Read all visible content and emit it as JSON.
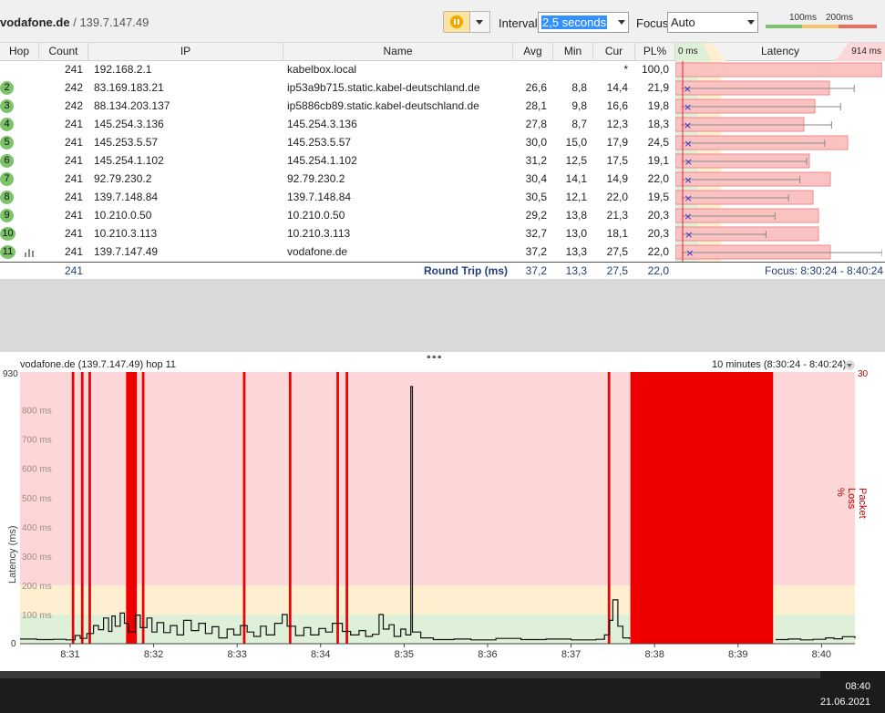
{
  "header": {
    "target_host": "vodafone.de",
    "separator": "/",
    "target_ip": "139.7.147.49",
    "interval_label": "Interval",
    "interval_value": "2,5 seconds",
    "focus_label": "Focus",
    "focus_value": "Auto",
    "scale_100": "100ms",
    "scale_200": "200ms",
    "pause_icon": "pause-icon"
  },
  "columns": {
    "hop": "Hop",
    "count": "Count",
    "ip": "IP",
    "name": "Name",
    "avg": "Avg",
    "min": "Min",
    "cur": "Cur",
    "pl": "PL%",
    "lat_min": "0 ms",
    "latency": "Latency",
    "lat_max": "914 ms"
  },
  "hops": [
    {
      "hop": "",
      "count": "241",
      "ip": "192.168.2.1",
      "name": "kabelbox.local",
      "avg": "",
      "min": "",
      "cur": "*",
      "pl": "100,0",
      "plf": 1.0,
      "avgv": 0,
      "minv": 0,
      "maxv": 0,
      "curv": 0
    },
    {
      "hop": "2",
      "count": "242",
      "ip": "83.169.183.21",
      "name": "ip53a9b715.static.kabel-deutschland.de",
      "avg": "26,6",
      "min": "8,8",
      "cur": "14,4",
      "pl": "21,9",
      "plf": 0.219,
      "avgv": 26.6,
      "minv": 8.8,
      "maxv": 790,
      "curv": 14.4
    },
    {
      "hop": "3",
      "count": "242",
      "ip": "88.134.203.137",
      "name": "ip5886cb89.static.kabel-deutschland.de",
      "avg": "28,1",
      "min": "9,8",
      "cur": "16,6",
      "pl": "19,8",
      "plf": 0.198,
      "avgv": 28.1,
      "minv": 9.8,
      "maxv": 730,
      "curv": 16.6
    },
    {
      "hop": "4",
      "count": "241",
      "ip": "145.254.3.136",
      "name": "145.254.3.136",
      "avg": "27,8",
      "min": "8,7",
      "cur": "12,3",
      "pl": "18,3",
      "plf": 0.183,
      "avgv": 27.8,
      "minv": 8.7,
      "maxv": 690,
      "curv": 12.3
    },
    {
      "hop": "5",
      "count": "241",
      "ip": "145.253.5.57",
      "name": "145.253.5.57",
      "avg": "30,0",
      "min": "15,0",
      "cur": "17,9",
      "pl": "24,5",
      "plf": 0.245,
      "avgv": 30.0,
      "minv": 15.0,
      "maxv": 660,
      "curv": 17.9
    },
    {
      "hop": "6",
      "count": "241",
      "ip": "145.254.1.102",
      "name": "145.254.1.102",
      "avg": "31,2",
      "min": "12,5",
      "cur": "17,5",
      "pl": "19,1",
      "plf": 0.191,
      "avgv": 31.2,
      "minv": 12.5,
      "maxv": 580,
      "curv": 17.5
    },
    {
      "hop": "7",
      "count": "241",
      "ip": "92.79.230.2",
      "name": "92.79.230.2",
      "avg": "30,4",
      "min": "14,1",
      "cur": "14,9",
      "pl": "22,0",
      "plf": 0.22,
      "avgv": 30.4,
      "minv": 14.1,
      "maxv": 550,
      "curv": 14.9
    },
    {
      "hop": "8",
      "count": "241",
      "ip": "139.7.148.84",
      "name": "139.7.148.84",
      "avg": "30,5",
      "min": "12,1",
      "cur": "22,0",
      "pl": "19,5",
      "plf": 0.195,
      "avgv": 30.5,
      "minv": 12.1,
      "maxv": 500,
      "curv": 22.0
    },
    {
      "hop": "9",
      "count": "241",
      "ip": "10.210.0.50",
      "name": "10.210.0.50",
      "avg": "29,2",
      "min": "13,8",
      "cur": "21,3",
      "pl": "20,3",
      "plf": 0.203,
      "avgv": 29.2,
      "minv": 13.8,
      "maxv": 440,
      "curv": 21.3
    },
    {
      "hop": "10",
      "count": "241",
      "ip": "10.210.3.113",
      "name": "10.210.3.113",
      "avg": "32,7",
      "min": "13,0",
      "cur": "18,1",
      "pl": "20,3",
      "plf": 0.203,
      "avgv": 32.7,
      "minv": 13.0,
      "maxv": 400,
      "curv": 18.1
    },
    {
      "hop": "11",
      "count": "241",
      "ip": "139.7.147.49",
      "name": "vodafone.de",
      "avg": "37,2",
      "min": "13,3",
      "cur": "27,5",
      "pl": "22,0",
      "plf": 0.22,
      "avgv": 37.2,
      "minv": 13.3,
      "maxv": 914,
      "curv": 27.5
    }
  ],
  "summary": {
    "count": "241",
    "label": "Round Trip (ms)",
    "avg": "37,2",
    "min": "13,3",
    "cur": "27,5",
    "pl": "22,0",
    "focus": "Focus: 8:30:24 - 8:40:24"
  },
  "graph": {
    "title": "vodafone.de (139.7.147.49) hop 11",
    "range": "10 minutes (8:30:24 - 8:40:24)",
    "y_axis_label": "Latency (ms)",
    "y2_axis_label": "Packet Loss %",
    "y_max_label": "930",
    "y_min_label": "0",
    "y2_max_label": "30"
  },
  "chart_data": {
    "type": "line",
    "xlabel": "",
    "ylabel": "Latency (ms)",
    "y2label": "Packet Loss %",
    "ylim": [
      0,
      930
    ],
    "y2lim": [
      0,
      30
    ],
    "x_ticks": [
      "8:31",
      "8:32",
      "8:33",
      "8:34",
      "8:35",
      "8:36",
      "8:37",
      "8:38",
      "8:39",
      "8:40"
    ],
    "x_tick_minutes": [
      0.6,
      1.6,
      2.6,
      3.6,
      4.6,
      5.6,
      6.6,
      7.6,
      8.6,
      9.6
    ],
    "y_gridlines": [
      "100 ms",
      "200 ms",
      "300 ms",
      "400 ms",
      "500 ms",
      "600 ms",
      "700 ms",
      "800 ms"
    ],
    "y_grid_values": [
      100,
      200,
      300,
      400,
      500,
      600,
      700,
      800
    ],
    "zones": [
      {
        "from": 0,
        "to": 100,
        "color": "#dff0d8"
      },
      {
        "from": 100,
        "to": 200,
        "color": "#fdefd0"
      },
      {
        "from": 200,
        "to": 930,
        "color": "#fdd7d7"
      }
    ],
    "loss_events_minutes": [
      [
        0.62,
        0.65
      ],
      [
        0.73,
        0.76
      ],
      [
        0.82,
        0.85
      ],
      [
        1.27,
        1.4
      ],
      [
        1.46,
        1.49
      ],
      [
        2.67,
        2.7
      ],
      [
        3.22,
        3.25
      ],
      [
        3.79,
        3.82
      ],
      [
        3.9,
        3.93
      ],
      [
        7.04,
        7.07
      ],
      [
        7.31,
        9.02
      ]
    ],
    "latency_ms": [
      {
        "t": 0.0,
        "v": 16
      },
      {
        "t": 0.2,
        "v": 14
      },
      {
        "t": 0.4,
        "v": 15
      },
      {
        "t": 0.55,
        "v": 13
      },
      {
        "t": 0.66,
        "v": 28
      },
      {
        "t": 0.72,
        "v": 18
      },
      {
        "t": 0.8,
        "v": 35
      },
      {
        "t": 0.88,
        "v": 62
      },
      {
        "t": 0.94,
        "v": 48
      },
      {
        "t": 1.0,
        "v": 88
      },
      {
        "t": 1.06,
        "v": 42
      },
      {
        "t": 1.1,
        "v": 95
      },
      {
        "t": 1.14,
        "v": 60
      },
      {
        "t": 1.2,
        "v": 105
      },
      {
        "t": 1.25,
        "v": 70
      },
      {
        "t": 1.3,
        "v": 40
      },
      {
        "t": 1.38,
        "v": 98
      },
      {
        "t": 1.44,
        "v": 55
      },
      {
        "t": 1.52,
        "v": 88
      },
      {
        "t": 1.58,
        "v": 40
      },
      {
        "t": 1.64,
        "v": 72
      },
      {
        "t": 1.72,
        "v": 38
      },
      {
        "t": 1.8,
        "v": 62
      },
      {
        "t": 1.88,
        "v": 30
      },
      {
        "t": 1.96,
        "v": 80
      },
      {
        "t": 2.05,
        "v": 45
      },
      {
        "t": 2.14,
        "v": 70
      },
      {
        "t": 2.22,
        "v": 35
      },
      {
        "t": 2.3,
        "v": 58
      },
      {
        "t": 2.38,
        "v": 20
      },
      {
        "t": 2.48,
        "v": 50
      },
      {
        "t": 2.56,
        "v": 30
      },
      {
        "t": 2.64,
        "v": 62
      },
      {
        "t": 2.72,
        "v": 40
      },
      {
        "t": 2.8,
        "v": 25
      },
      {
        "t": 2.88,
        "v": 60
      },
      {
        "t": 2.95,
        "v": 30
      },
      {
        "t": 3.05,
        "v": 70
      },
      {
        "t": 3.14,
        "v": 100
      },
      {
        "t": 3.2,
        "v": 60
      },
      {
        "t": 3.3,
        "v": 28
      },
      {
        "t": 3.4,
        "v": 55
      },
      {
        "t": 3.48,
        "v": 30
      },
      {
        "t": 3.58,
        "v": 52
      },
      {
        "t": 3.66,
        "v": 40
      },
      {
        "t": 3.74,
        "v": 70
      },
      {
        "t": 3.86,
        "v": 42
      },
      {
        "t": 3.96,
        "v": 30
      },
      {
        "t": 4.06,
        "v": 45
      },
      {
        "t": 4.14,
        "v": 25
      },
      {
        "t": 4.22,
        "v": 32
      },
      {
        "t": 4.3,
        "v": 100
      },
      {
        "t": 4.35,
        "v": 50
      },
      {
        "t": 4.42,
        "v": 65
      },
      {
        "t": 4.48,
        "v": 25
      },
      {
        "t": 4.56,
        "v": 50
      },
      {
        "t": 4.62,
        "v": 30
      },
      {
        "t": 4.68,
        "v": 880
      },
      {
        "t": 4.7,
        "v": 40
      },
      {
        "t": 4.8,
        "v": 20
      },
      {
        "t": 4.95,
        "v": 14
      },
      {
        "t": 5.2,
        "v": 16
      },
      {
        "t": 5.4,
        "v": 13
      },
      {
        "t": 5.7,
        "v": 18
      },
      {
        "t": 6.0,
        "v": 14
      },
      {
        "t": 6.3,
        "v": 16
      },
      {
        "t": 6.6,
        "v": 13
      },
      {
        "t": 6.9,
        "v": 15
      },
      {
        "t": 7.0,
        "v": 30
      },
      {
        "t": 7.06,
        "v": 80
      },
      {
        "t": 7.1,
        "v": 150
      },
      {
        "t": 7.16,
        "v": 60
      },
      {
        "t": 7.22,
        "v": 20
      },
      {
        "t": 7.3,
        "v": 16
      },
      {
        "t": 9.05,
        "v": 14
      },
      {
        "t": 9.2,
        "v": 16
      },
      {
        "t": 9.35,
        "v": 13
      },
      {
        "t": 9.5,
        "v": 15
      },
      {
        "t": 9.65,
        "v": 20
      },
      {
        "t": 9.75,
        "v": 17
      },
      {
        "t": 9.85,
        "v": 24
      },
      {
        "t": 10.0,
        "v": 18
      }
    ]
  },
  "taskbar": {
    "time": "08:40",
    "date": "21.06.2021"
  }
}
